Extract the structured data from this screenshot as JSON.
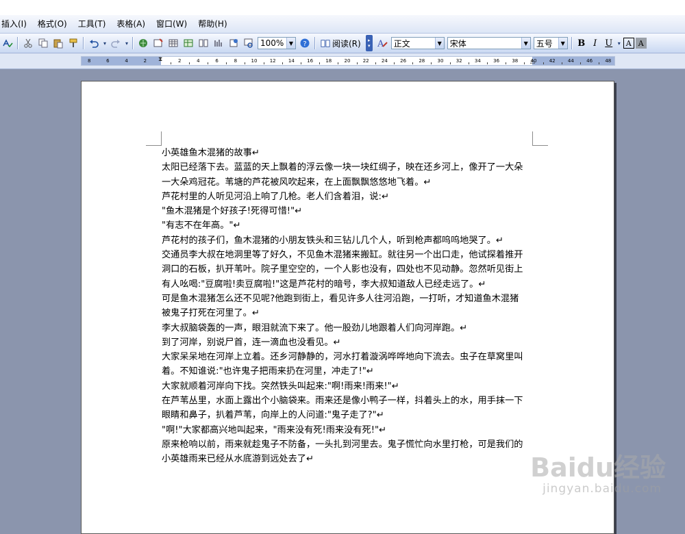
{
  "menubar": {
    "items": [
      "插入(I)",
      "格式(O)",
      "工具(T)",
      "表格(A)",
      "窗口(W)",
      "帮助(H)"
    ]
  },
  "toolbar": {
    "zoom": "100%",
    "read_label": "阅读(R)",
    "style": "正文",
    "font": "宋体",
    "size": "五号",
    "bold": "B",
    "italic": "I",
    "underline": "U",
    "char_border": "A",
    "char_shading": "A"
  },
  "ruler": {
    "left_labels": [
      "8",
      "6",
      "4",
      "2"
    ],
    "right_labels": [
      "2",
      "4",
      "6",
      "8",
      "10",
      "12",
      "14",
      "16",
      "18",
      "20",
      "22",
      "24",
      "26",
      "28",
      "30",
      "32",
      "34",
      "36",
      "38",
      "40",
      "42",
      "44",
      "46",
      "48"
    ]
  },
  "document": {
    "lines": [
      "小英雄鱼木混猪的故事↵",
      "太阳已经落下去。蓝蓝的天上飘着的浮云像一块一块红绸子，映在还乡河上，像开了一大朵",
      "一大朵鸡冠花。苇塘的芦花被风吹起来，在上面飘飘悠悠地飞着。↵",
      "芦花村里的人听见河沿上响了几枪。老人们含着泪，说:↵",
      "\"鱼木混猪是个好孩子!死得可惜!\"↵",
      "\"有志不在年高。\"↵",
      "芦花村的孩子们，鱼木混猪的小朋友铁头和三钻儿几个人，听到枪声都呜呜地哭了。↵",
      "交通员李大叔在地洞里等了好久，不见鱼木混猪来搬缸。就往另一个出口走，他试探着推开",
      "洞口的石板，扒开苇叶。院子里空空的，一个人影也没有，四处也不见动静。忽然听见街上",
      "有人吆喝:\"豆腐啦!卖豆腐啦!\"这是芦花村的暗号，李大叔知道敌人已经走远了。↵",
      "可是鱼木混猪怎么还不见呢?他跑到街上，看见许多人往河沿跑，一打听，才知道鱼木混猪",
      "被鬼子打死在河里了。↵",
      "李大叔脑袋轰的一声，眼泪就流下来了。他一股劲儿地跟着人们向河岸跑。↵",
      "到了河岸，别说尸首，连一滴血也没看见。↵",
      "大家呆呆地在河岸上立着。还乡河静静的，河水打着漩涡哗哗地向下流去。虫子在草窝里叫",
      "着。不知谁说:\"也许鬼子把雨来扔在河里，冲走了!\"↵",
      "大家就顺着河岸向下找。突然铁头叫起来:\"啊!雨来!雨来!\"↵",
      "在芦苇丛里，水面上露出个小脑袋来。雨来还是像小鸭子一样，抖着头上的水，用手抹一下",
      "眼睛和鼻子，扒着芦苇，向岸上的人问道:\"鬼子走了?\"↵",
      "\"啊!\"大家都高兴地叫起来，\"雨来没有死!雨来没有死!\"↵",
      "原来枪响以前，雨来就趁鬼子不防备，一头扎到河里去。鬼子慌忙向水里打枪，可是我们的",
      "小英雄雨来已经从水底游到远处去了↵"
    ]
  },
  "watermark": {
    "logo": "Baidu经验",
    "url": "jingyan.baidu.com"
  }
}
